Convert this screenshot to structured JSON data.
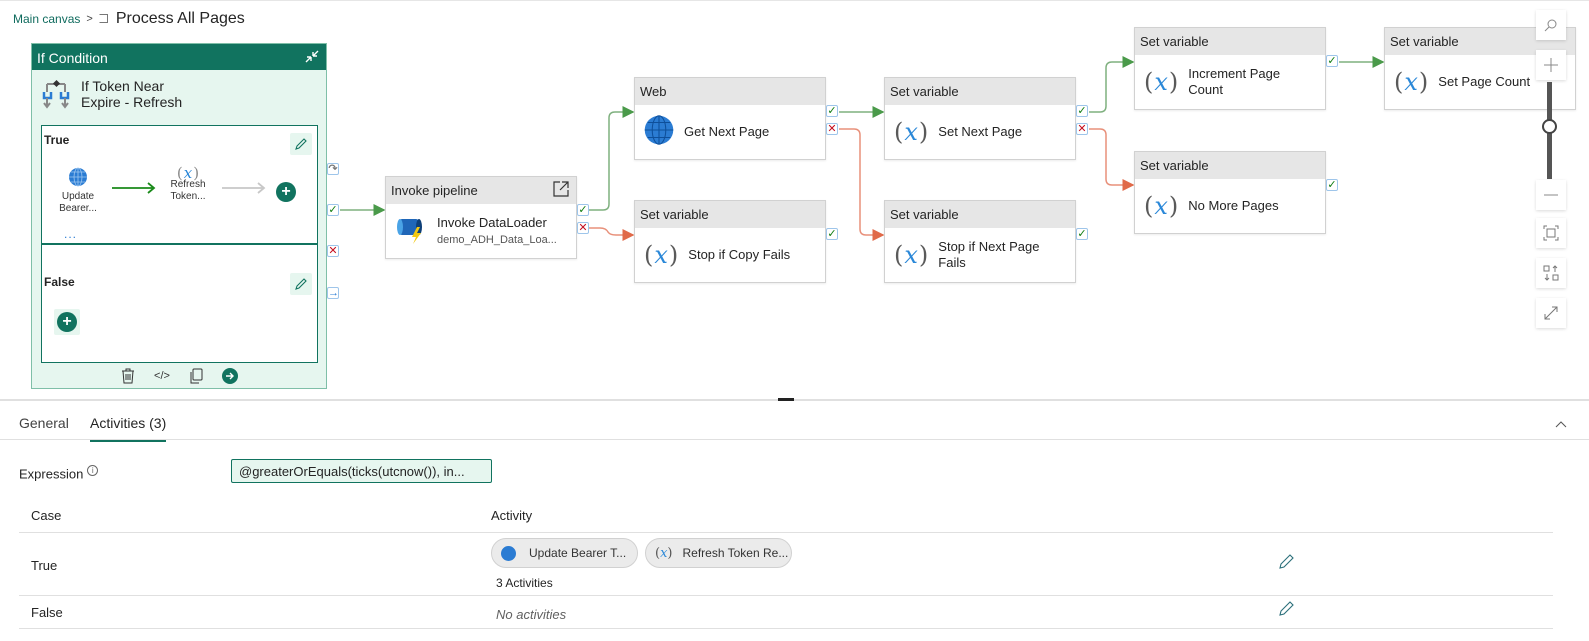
{
  "breadcrumb": {
    "root": "Main canvas",
    "separator": ">",
    "current": "Process All Pages"
  },
  "if_condition": {
    "header": "If Condition",
    "name": "If Token Near Expire - Refresh",
    "name_line1": "If Token Near",
    "name_line2": "Expire - Refresh",
    "true_branch": {
      "label": "True",
      "activities": [
        {
          "icon": "globe-icon",
          "line1": "Update",
          "line2": "Bearer..."
        },
        {
          "icon": "variable-icon",
          "line1": "Refresh",
          "line2": "Token..."
        }
      ],
      "more": "..."
    },
    "false_branch": {
      "label": "False"
    },
    "toolbar": [
      "delete-icon",
      "code-icon",
      "copy-icon",
      "go-to-icon"
    ]
  },
  "nodes": {
    "invoke": {
      "type": "Invoke pipeline",
      "name": "Invoke DataLoader",
      "sub": "demo_ADH_Data_Loa..."
    },
    "get_next_page": {
      "type": "Web",
      "name": "Get Next Page"
    },
    "stop_copy": {
      "type": "Set variable",
      "name": "Stop if Copy Fails"
    },
    "set_next_page": {
      "type": "Set variable",
      "name": "Set Next Page"
    },
    "stop_next": {
      "type": "Set variable",
      "name_line1": "Stop if Next Page",
      "name_line2": "Fails"
    },
    "increment": {
      "type": "Set variable",
      "name_line1": "Increment Page",
      "name_line2": "Count"
    },
    "no_more": {
      "type": "Set variable",
      "name": "No More Pages"
    },
    "set_count": {
      "type": "Set variable",
      "name": "Set Page Count"
    }
  },
  "colors": {
    "accent": "#11735f",
    "success": "#107c10",
    "failure": "#c50f1f",
    "success_link": "#5ba35b",
    "failure_link": "#e07a5f"
  },
  "canvas_controls": [
    "search-icon",
    "zoom-in-icon",
    "zoom-out-icon",
    "fit-to-screen-icon",
    "auto-align-icon",
    "expand-icon"
  ],
  "zoom_level_fraction": 0.55,
  "panel": {
    "tabs": [
      {
        "label": "General",
        "active": false
      },
      {
        "label": "Activities (3)",
        "active": true
      }
    ],
    "expression_label": "Expression",
    "expression_value": "@greaterOrEquals(ticks(utcnow()), in...",
    "table": {
      "headers": [
        "Case",
        "Activity"
      ],
      "rows": [
        {
          "case": "True",
          "activities": [
            {
              "icon": "globe-icon",
              "label": "Update Bearer T..."
            },
            {
              "icon": "variable-icon",
              "label": "Refresh Token Re..."
            }
          ],
          "summary": "3 Activities"
        },
        {
          "case": "False",
          "activities": [],
          "summary": "No activities"
        }
      ]
    }
  }
}
